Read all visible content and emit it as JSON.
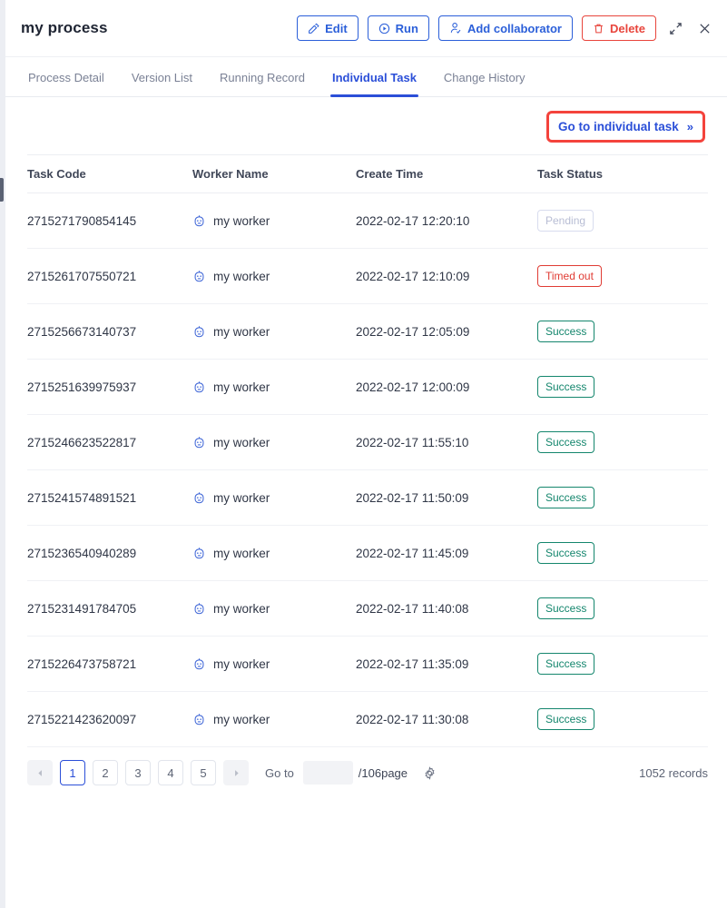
{
  "header": {
    "title": "my process",
    "buttons": [
      {
        "label": "Edit",
        "icon": "edit-icon",
        "variant": "primary"
      },
      {
        "label": "Run",
        "icon": "play-circle-icon",
        "variant": "primary"
      },
      {
        "label": "Add collaborator",
        "icon": "user-add-icon",
        "variant": "primary"
      },
      {
        "label": "Delete",
        "icon": "trash-icon",
        "variant": "danger"
      }
    ],
    "expand_icon": "expand-icon",
    "close_icon": "close-icon"
  },
  "tabs": [
    {
      "label": "Process Detail",
      "active": false
    },
    {
      "label": "Version List",
      "active": false
    },
    {
      "label": "Running Record",
      "active": false
    },
    {
      "label": "Individual Task",
      "active": true
    },
    {
      "label": "Change History",
      "active": false
    }
  ],
  "toolbar": {
    "goto_individual_task": "Go to individual task",
    "goto_chevron": "»",
    "highlight_color": "#f4433c"
  },
  "table": {
    "columns": [
      "Task Code",
      "Worker Name",
      "Create Time",
      "Task Status"
    ],
    "rows": [
      {
        "code": "2715271790854145",
        "worker": "my worker",
        "time": "2022-02-17 12:20:10",
        "status": "Pending",
        "status_kind": "pending"
      },
      {
        "code": "2715261707550721",
        "worker": "my worker",
        "time": "2022-02-17 12:10:09",
        "status": "Timed out",
        "status_kind": "timedout"
      },
      {
        "code": "2715256673140737",
        "worker": "my worker",
        "time": "2022-02-17 12:05:09",
        "status": "Success",
        "status_kind": "success"
      },
      {
        "code": "2715251639975937",
        "worker": "my worker",
        "time": "2022-02-17 12:00:09",
        "status": "Success",
        "status_kind": "success"
      },
      {
        "code": "2715246623522817",
        "worker": "my worker",
        "time": "2022-02-17 11:55:10",
        "status": "Success",
        "status_kind": "success"
      },
      {
        "code": "2715241574891521",
        "worker": "my worker",
        "time": "2022-02-17 11:50:09",
        "status": "Success",
        "status_kind": "success"
      },
      {
        "code": "2715236540940289",
        "worker": "my worker",
        "time": "2022-02-17 11:45:09",
        "status": "Success",
        "status_kind": "success"
      },
      {
        "code": "2715231491784705",
        "worker": "my worker",
        "time": "2022-02-17 11:40:08",
        "status": "Success",
        "status_kind": "success"
      },
      {
        "code": "2715226473758721",
        "worker": "my worker",
        "time": "2022-02-17 11:35:09",
        "status": "Success",
        "status_kind": "success"
      },
      {
        "code": "2715221423620097",
        "worker": "my worker",
        "time": "2022-02-17 11:30:08",
        "status": "Success",
        "status_kind": "success"
      }
    ]
  },
  "pagination": {
    "prev_icon": "caret-left-icon",
    "next_icon": "caret-right-icon",
    "pages": [
      "1",
      "2",
      "3",
      "4",
      "5"
    ],
    "current_page": "1",
    "goto_label": "Go to",
    "goto_value": "",
    "goto_placeholder": "",
    "page_total": "/106page",
    "settings_icon": "gear-icon",
    "records": "1052 records"
  },
  "colors": {
    "accent": "#2b4fd8",
    "danger": "#e8453c",
    "success": "#14866d",
    "muted": "#b8bdd4"
  }
}
